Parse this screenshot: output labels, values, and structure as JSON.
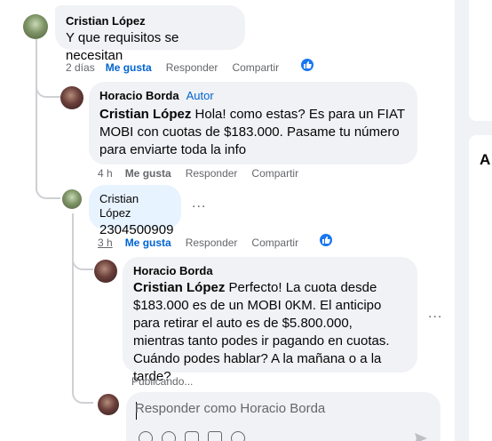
{
  "comments": [
    {
      "author": "Cristian López",
      "text": "Y que requisitos se necesitan",
      "time": "2 días",
      "like": "Me gusta",
      "reply": "Responder",
      "share": "Compartir",
      "reaction": "like"
    },
    {
      "author": "Horacio Borda",
      "badge": "Autor",
      "mention": "Cristian López",
      "text": " Hola! como estas? Es para un FIAT MOBI con cuotas de $183.000. Pasame tu número para enviarte toda la info",
      "time": "4 h",
      "like": "Me gusta",
      "reply": "Responder",
      "share": "Compartir"
    },
    {
      "author": "Cristian López",
      "text": "2304500909",
      "time": "3 h",
      "like": "Me gusta",
      "reply": "Responder",
      "share": "Compartir",
      "reaction": "like",
      "more": "..."
    },
    {
      "author": "Horacio Borda",
      "mention": "Cristian López",
      "text": " Perfecto! La cuota desde $183.000 es de un MOBI 0KM. El anticipo para retirar el auto es de $5.800.000, mientras tanto podes ir pagando en cuotas. Cuándo podes hablar? A la mañana o a la tarde?",
      "status": "Publicando...",
      "more": "..."
    }
  ],
  "reply_box": {
    "placeholder": "Responder como Horacio Borda",
    "tools": [
      "avatar-sticker-icon",
      "emoji-icon",
      "camera-icon",
      "gif-icon",
      "sticker-icon"
    ]
  },
  "sidebar": {
    "heading": "A"
  },
  "colors": {
    "link": "#0064d1",
    "bubble": "#f0f2f5",
    "muted": "#65676b",
    "reaction": "#1877f2"
  }
}
